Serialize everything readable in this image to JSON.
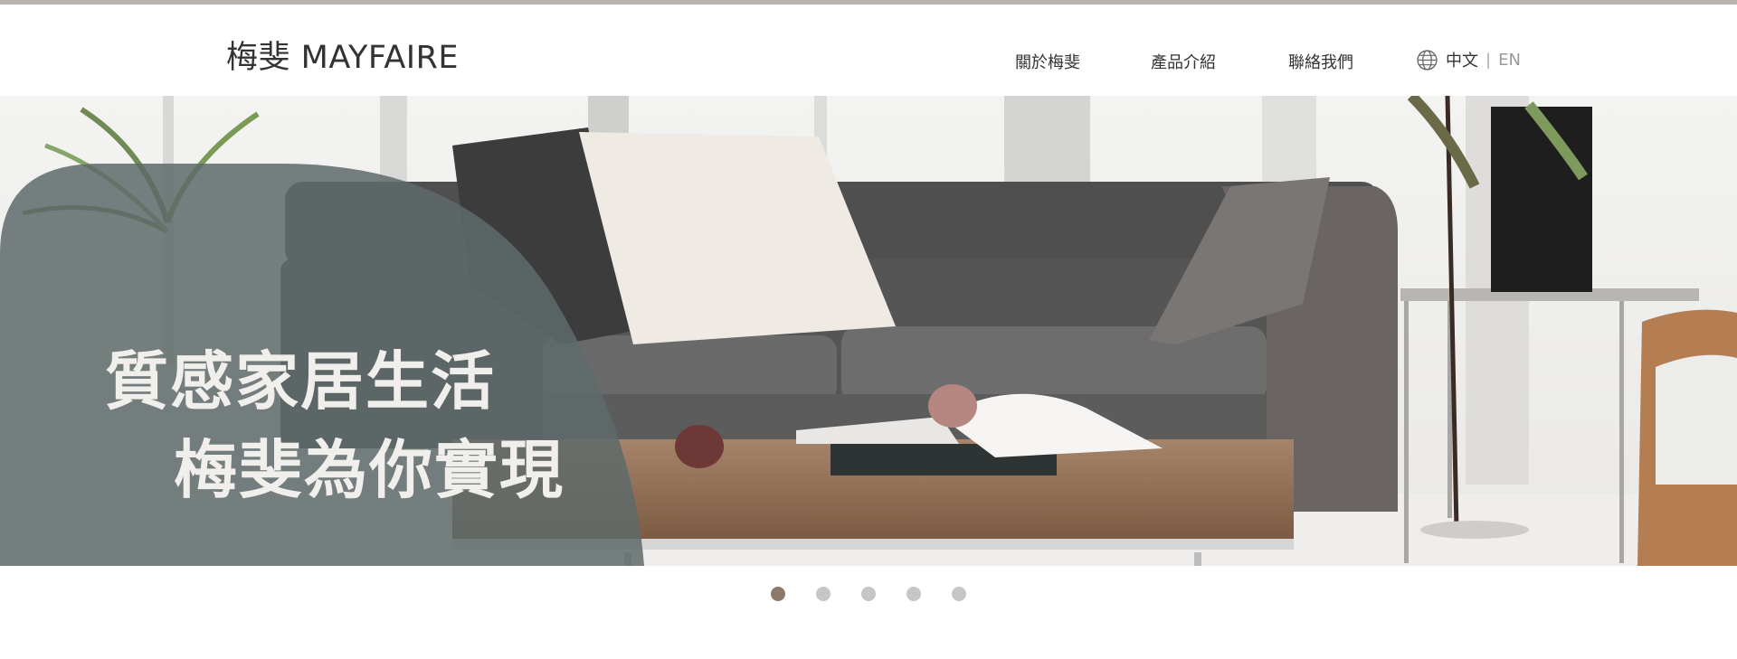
{
  "header": {
    "logo_text": "梅斐 MAYFAIRE",
    "nav": [
      {
        "label": "關於梅斐"
      },
      {
        "label": "產品介紹"
      },
      {
        "label": "聯絡我們"
      }
    ],
    "language": {
      "icon": "globe-icon",
      "current": "中文",
      "separator": "|",
      "alternate": "EN"
    }
  },
  "banner": {
    "headline_line1": "質感家居生活",
    "headline_line2": "梅斐為你實現",
    "colors": {
      "overlay": "#5e6a6a",
      "sofa": "#4a4a4a",
      "table_wood": "#8b6a50"
    }
  },
  "carousel": {
    "slide_count": 5,
    "active_index": 0,
    "active_color": "#8b7a69",
    "inactive_color": "#c6c6c6"
  }
}
